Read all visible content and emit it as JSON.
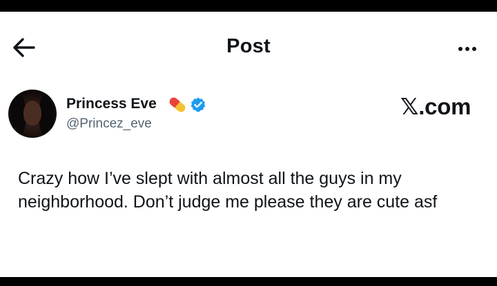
{
  "header": {
    "back_icon": "arrow-left-icon",
    "title": "Post",
    "more_icon": "more-horizontal-icon"
  },
  "post": {
    "author": {
      "name": "Princess Eve",
      "emoji_icon": "pill-emoji-icon",
      "verified_icon": "verified-badge-icon",
      "handle": "@Princez_eve"
    },
    "watermark": "𝕏.com",
    "text": "Crazy how I’ve slept with almost all the guys in my neighborhood. Don’t judge me please they are cute asf"
  },
  "colors": {
    "background": "#ffffff",
    "text": "#0f1419",
    "secondary_text": "#536471",
    "verified_blue": "#1d9bf0",
    "letterbox": "#000000"
  }
}
